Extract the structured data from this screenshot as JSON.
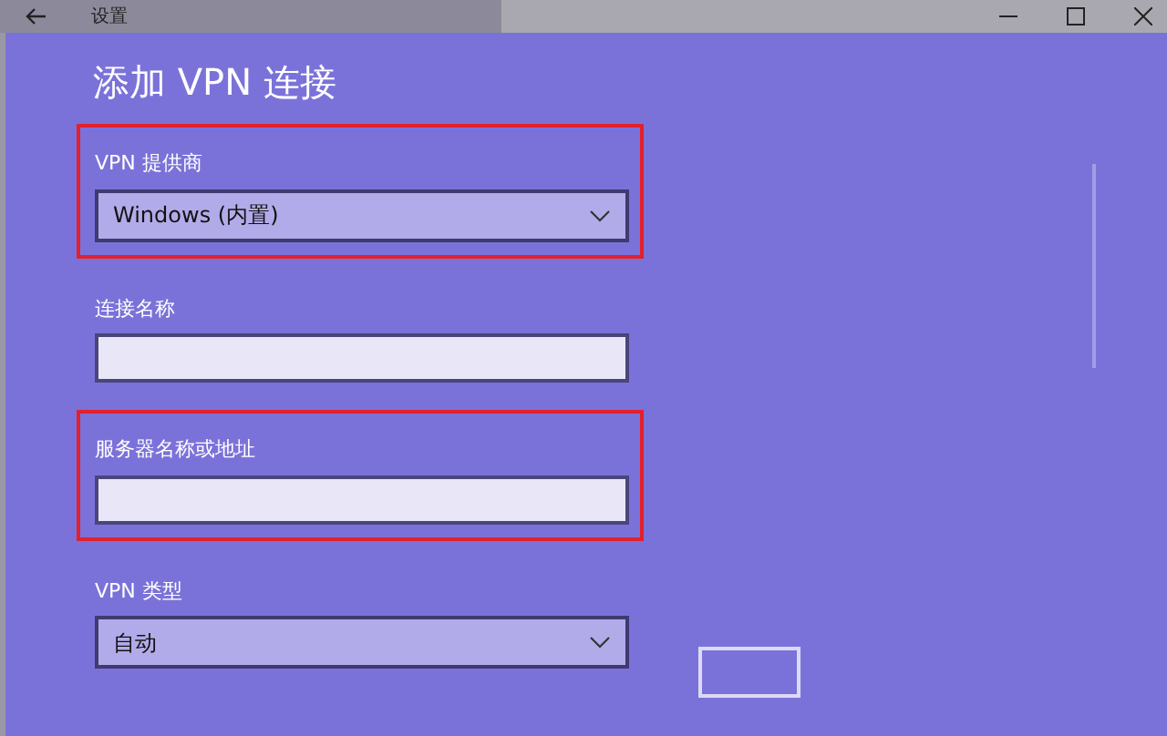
{
  "window": {
    "title": "设置"
  },
  "page": {
    "heading": "添加 VPN 连接"
  },
  "fields": [
    {
      "kind": "dropdown",
      "label": "VPN 提供商",
      "value": "Windows (内置)",
      "highlighted": true
    },
    {
      "kind": "text",
      "label": "连接名称",
      "highlighted": false
    },
    {
      "kind": "text",
      "label": "服务器名称或地址",
      "highlighted": true
    },
    {
      "kind": "dropdown",
      "label": "VPN 类型",
      "value": "自动",
      "highlighted": false
    }
  ]
}
